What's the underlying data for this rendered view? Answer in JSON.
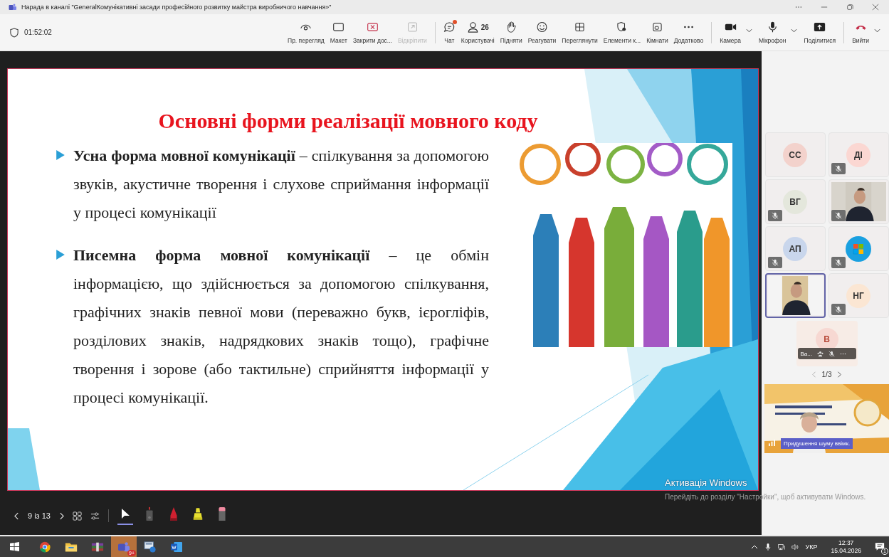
{
  "window": {
    "title": "Нарада в каналі \"GeneralКомунікативні засади професійного розвитку майстра виробничого навчання»\""
  },
  "toolbar": {
    "timer": "01:52:02",
    "groups": [
      [
        {
          "label": "Пр. перегляд",
          "disabled": false
        },
        {
          "label": "Макет",
          "disabled": false
        },
        {
          "label": "Закрити дос...",
          "disabled": false
        },
        {
          "label": "Відкріпити",
          "disabled": true
        }
      ],
      [
        {
          "label": "Чат",
          "disabled": false,
          "notification": true
        },
        {
          "label": "Користувачі",
          "disabled": false,
          "count": "26"
        },
        {
          "label": "Підняти",
          "disabled": false
        },
        {
          "label": "Реагувати",
          "disabled": false
        },
        {
          "label": "Переглянути",
          "disabled": false
        },
        {
          "label": "Елементи к...",
          "disabled": false
        },
        {
          "label": "Кімнати",
          "disabled": false
        },
        {
          "label": "Додатково",
          "disabled": false
        }
      ],
      [
        {
          "label": "Камера",
          "disabled": false,
          "dropdown": true
        },
        {
          "label": "Мікрофон",
          "disabled": false,
          "dropdown": true
        },
        {
          "label": "Поділитися",
          "disabled": false
        }
      ],
      [
        {
          "label": "Вийти",
          "disabled": false,
          "dropdown": true
        }
      ]
    ]
  },
  "slide": {
    "title": "Основні форми реалізації мовного коду",
    "bullets": [
      "**Усна форма мовної комунікації** – спілкування за допомогою звуків, акустичне творення і слухове сприймання інформації у процесі комунікації",
      "**Писемна форма мовної комунікації** – це обмін інформацією, що здійснюється за допомогою спілкування, графічних знаків певної мови (переважно букв, ієрогліфів, розділових знаків, надрядкових знаків тощо), графічне творення і зорове (або тактильне) сприйняття інформації у процесі комунікації."
    ]
  },
  "presenter_bar": {
    "counter": "9 із 13",
    "tools": [
      {
        "kind": "pointer",
        "selected": true
      },
      {
        "kind": "laser",
        "selected": false
      },
      {
        "kind": "pen",
        "selected": false
      },
      {
        "kind": "highlighter",
        "selected": false
      },
      {
        "kind": "eraser",
        "selected": false
      }
    ]
  },
  "participants": [
    {
      "kind": "avatar",
      "initials": "СС",
      "color": "#f3d2cc",
      "muted": false,
      "selected": false
    },
    {
      "kind": "avatar",
      "initials": "ДІ",
      "color": "#fbd7d2",
      "muted": true,
      "selected": false
    },
    {
      "kind": "avatar",
      "initials": "ВГ",
      "color": "#e4e7dc",
      "muted": true,
      "selected": false
    },
    {
      "kind": "video",
      "muted": true,
      "selected": false
    },
    {
      "kind": "avatar",
      "initials": "АП",
      "color": "#c9d6ec",
      "muted": true,
      "selected": false
    },
    {
      "kind": "logo",
      "muted": true,
      "selected": false
    },
    {
      "kind": "video",
      "muted": false,
      "selected": true
    },
    {
      "kind": "avatar",
      "initials": "НГ",
      "color": "#fbe6d3",
      "muted": true,
      "selected": false
    }
  ],
  "overflow_tile": {
    "initials": "В",
    "name": "Ва...",
    "muted": true
  },
  "pager": "1/3",
  "speaker": {
    "badge": "Придушення шуму ввімк."
  },
  "activation": {
    "title": "Активація Windows",
    "text": "Перейдіть до розділу \"Настройки\", щоб активувати Windows."
  },
  "taskbar": {
    "apps": [
      {
        "kind": "browser",
        "active": false
      },
      {
        "kind": "folder",
        "active": false
      },
      {
        "kind": "archive",
        "active": false
      },
      {
        "kind": "teams",
        "active": true,
        "badge": "9+"
      },
      {
        "kind": "network-app",
        "active": false
      },
      {
        "kind": "document",
        "active": false
      }
    ],
    "language": "УКР",
    "time": "12:37",
    "date": "15.04.2026",
    "notifications": "1"
  }
}
